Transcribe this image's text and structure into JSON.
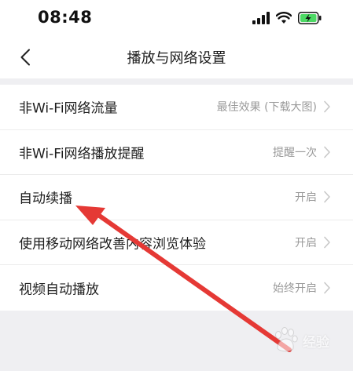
{
  "status_bar": {
    "time": "08:48",
    "icons": [
      "cellular-signal-icon",
      "wifi-icon",
      "battery-charging-icon"
    ]
  },
  "nav": {
    "title": "播放与网络设置",
    "back_icon": "chevron-left-icon"
  },
  "settings": [
    {
      "label": "非Wi-Fi网络流量",
      "value": "最佳效果 (下载大图)"
    },
    {
      "label": "非Wi-Fi网络播放提醒",
      "value": "提醒一次"
    },
    {
      "label": "自动续播",
      "value": "开启"
    },
    {
      "label": "使用移动网络改善内容浏览体验",
      "value": "开启"
    },
    {
      "label": "视频自动播放",
      "value": "始终开启"
    }
  ],
  "annotation": {
    "arrow_color": "#e53935",
    "points_to": "自动续播"
  },
  "watermark": {
    "text": "经验",
    "logo": "baidu-paw-logo"
  },
  "colors": {
    "background": "#efeff2",
    "surface": "#ffffff",
    "battery": "#4cd964"
  }
}
